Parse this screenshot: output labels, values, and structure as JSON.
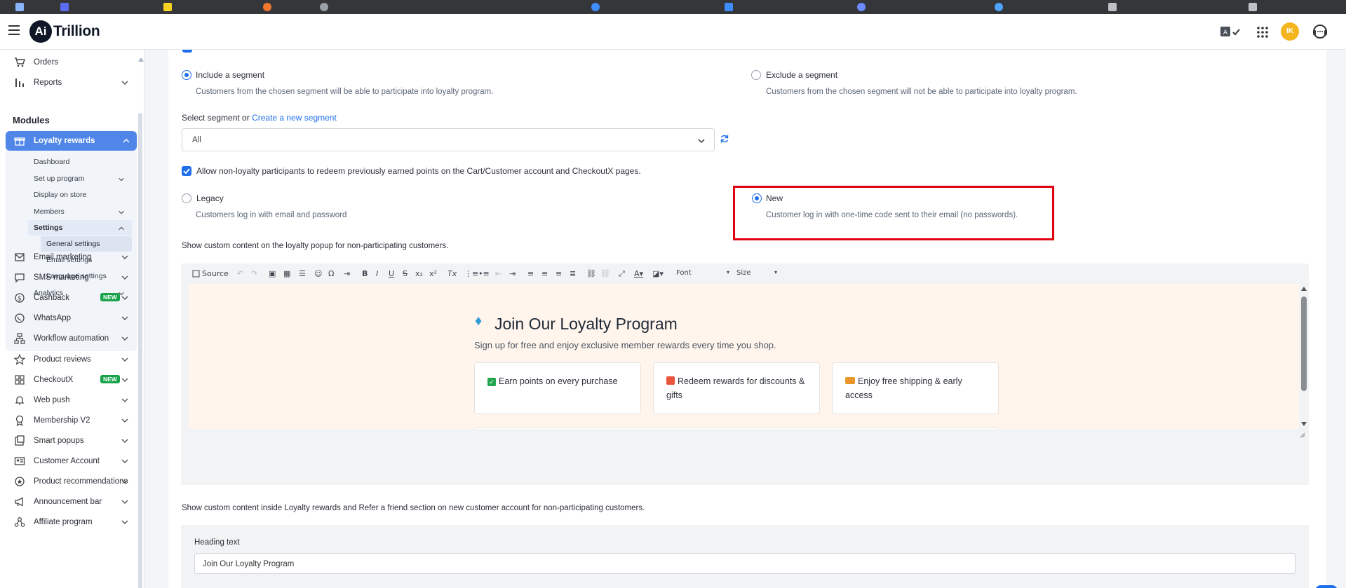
{
  "app": {
    "logo_mark": "Ai",
    "logo_name": "Trillion",
    "avatar_initials": "IK",
    "accent": "#1f6feb",
    "highlight": "#e00010",
    "new_badge_color": "#17a34a"
  },
  "topbar_icons": [
    "translate-icon",
    "apps-grid-icon",
    "support-headset-icon"
  ],
  "sidebar": {
    "top_items": [
      {
        "label": "Orders",
        "icon": "cart-icon"
      },
      {
        "label": "Reports",
        "icon": "bar-chart-icon"
      }
    ],
    "modules_heading": "Modules",
    "active_item": {
      "label": "Loyalty rewards",
      "icon": "gift-icon"
    },
    "loyalty_sub": [
      "Dashboard",
      "Set up program",
      "Display on store",
      "Members",
      "Settings"
    ],
    "settings_sub": [
      "General settings",
      "Email settings",
      "Language settings"
    ],
    "analytics": "Analytics",
    "items": [
      {
        "label": "Email marketing",
        "icon": "mail-icon",
        "badge": ""
      },
      {
        "label": "SMS marketing",
        "icon": "chat-icon",
        "badge": ""
      },
      {
        "label": "Cashback",
        "icon": "dollar-icon",
        "badge": "NEW"
      },
      {
        "label": "WhatsApp",
        "icon": "whatsapp-icon",
        "badge": ""
      },
      {
        "label": "Workflow automation",
        "icon": "workflow-icon",
        "badge": ""
      },
      {
        "label": "Product reviews",
        "icon": "star-icon",
        "badge": ""
      },
      {
        "label": "CheckoutX",
        "icon": "checkout-icon",
        "badge": "NEW"
      },
      {
        "label": "Web push",
        "icon": "bell-icon",
        "badge": ""
      },
      {
        "label": "Membership V2",
        "icon": "badge-icon",
        "badge": ""
      },
      {
        "label": "Smart popups",
        "icon": "popup-icon",
        "badge": ""
      },
      {
        "label": "Customer Account",
        "icon": "id-card-icon",
        "badge": ""
      },
      {
        "label": "Product recommendations",
        "icon": "recommend-icon",
        "badge": ""
      },
      {
        "label": "Announcement bar",
        "icon": "megaphone-icon",
        "badge": ""
      },
      {
        "label": "Affiliate program",
        "icon": "affiliate-icon",
        "badge": ""
      }
    ]
  },
  "segment": {
    "include_label": "Include a segment",
    "include_desc": "Customers from the chosen segment will be able to participate into loyalty program.",
    "exclude_label": "Exclude a segment",
    "exclude_desc": "Customers from the chosen segment will not be able to participate into loyalty program.",
    "selected": "include",
    "select_label": "Select segment or",
    "create_link": "Create a new segment",
    "select_value": "All"
  },
  "allow_redeem": {
    "label": "Allow non-loyalty participants to redeem previously earned points on the Cart/Customer account and CheckoutX pages.",
    "checked": true
  },
  "login_mode": {
    "legacy_label": "Legacy",
    "legacy_desc": "Customers log in with email and password",
    "new_label": "New",
    "new_desc": "Customer log in with one-time code sent to their email (no passwords).",
    "selected": "new"
  },
  "popup_content": {
    "label": "Show custom content on the loyalty popup for non-participating customers.",
    "toolbar": {
      "source": "Source",
      "font": "Font",
      "size": "Size"
    },
    "heading": "Join Our Loyalty Program",
    "subheading": "Sign up for free and enjoy exclusive member rewards every time you shop.",
    "cards": [
      "Earn points on every purchase",
      "Redeem rewards for discounts & gifts",
      "Enjoy free shipping & early access"
    ]
  },
  "account_content": {
    "label": "Show custom content inside Loyalty rewards and Refer a friend section on new customer account for non-participating customers.",
    "heading_label": "Heading text",
    "heading_value": "Join Our Loyalty Program"
  }
}
